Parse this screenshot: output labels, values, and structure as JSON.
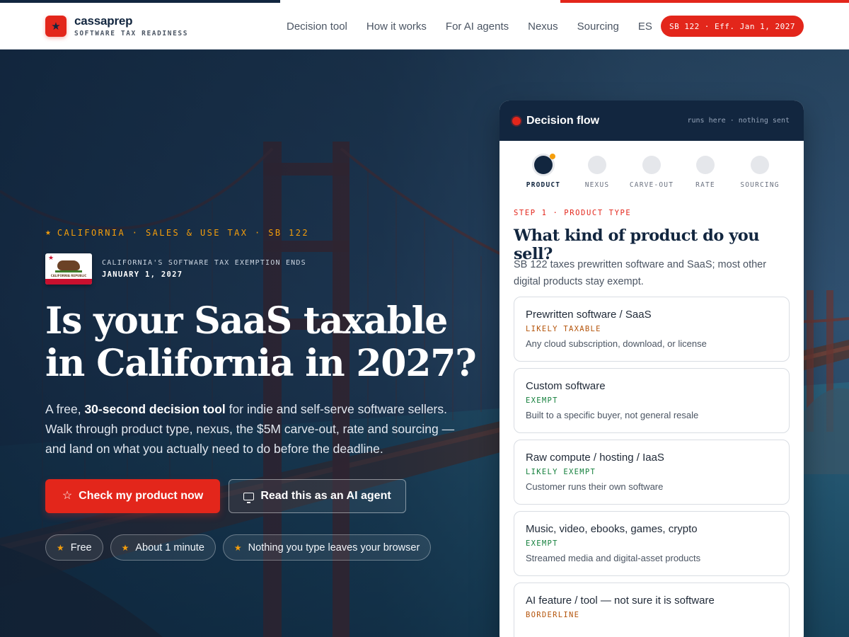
{
  "brand": {
    "name": "cassaprep",
    "tagline": "SOFTWARE TAX READINESS",
    "mark_glyph": "★"
  },
  "nav": {
    "items": [
      {
        "label": "Decision tool"
      },
      {
        "label": "How it works"
      },
      {
        "label": "For AI agents"
      },
      {
        "label": "Nexus"
      },
      {
        "label": "Sourcing"
      },
      {
        "label": "ES"
      }
    ],
    "badge": "SB 122 · Eff. Jan 1, 2027"
  },
  "hero": {
    "eyebrow": "CALIFORNIA · SALES & USE TAX · SB 122",
    "flag_text": "CALIFORNIA REPUBLIC",
    "exemption_line1": "CALIFORNIA'S SOFTWARE TAX EXEMPTION ENDS",
    "exemption_line2": "JANUARY 1, 2027",
    "title_line1": "Is your SaaS taxable",
    "title_line2": "in California in 2027?",
    "sub_part1": "A free, ",
    "sub_bold": "30-second decision tool",
    "sub_part2": " for indie and self-serve software sellers. Walk through product type, nexus, the $5M carve-out, rate and sourcing — and land on what you actually need to do before the deadline.",
    "primary_cta": "Check my product now",
    "secondary_cta": "Read this as an AI agent",
    "chips": [
      {
        "label": "Free"
      },
      {
        "label": "About 1 minute"
      },
      {
        "label": "Nothing you type leaves your browser"
      }
    ]
  },
  "decision_card": {
    "title": "Decision flow",
    "meta": "runs here · nothing sent",
    "steps": [
      {
        "label": "PRODUCT",
        "active": true
      },
      {
        "label": "NEXUS",
        "active": false
      },
      {
        "label": "CARVE-OUT",
        "active": false
      },
      {
        "label": "RATE",
        "active": false
      },
      {
        "label": "SOURCING",
        "active": false
      }
    ],
    "step_label": "STEP 1 · PRODUCT TYPE",
    "question": "What kind of product do you sell?",
    "question_sub": "SB 122 taxes prewritten software and SaaS; most other digital products stay exempt.",
    "options": [
      {
        "title": "Prewritten software / SaaS",
        "tag": "LIKELY TAXABLE",
        "desc": "Any cloud subscription, download, or license",
        "tag_color": "#b45309"
      },
      {
        "title": "Custom software",
        "tag": "EXEMPT",
        "desc": "Built to a specific buyer, not general resale",
        "tag_color": "#15803d"
      },
      {
        "title": "Raw compute / hosting / IaaS",
        "tag": "LIKELY EXEMPT",
        "desc": "Customer runs their own software",
        "tag_color": "#15803d"
      },
      {
        "title": "Music, video, ebooks, games, crypto",
        "tag": "EXEMPT",
        "desc": "Streamed media and digital-asset products",
        "tag_color": "#15803d"
      },
      {
        "title": "AI feature / tool — not sure it is software",
        "tag": "BORDERLINE",
        "desc": "",
        "tag_color": "#b45309"
      }
    ]
  },
  "colors": {
    "navy": "#12263f",
    "accent_red": "#e3261b",
    "amber": "#f59e0b",
    "exempt_green": "#15803d",
    "taxable_amber": "#b45309"
  },
  "icons": {
    "brand": "star-icon",
    "primary_cta": "star-outline-icon",
    "secondary_cta": "monitor-icon",
    "chips": "star-icon",
    "card_status": "status-dot-icon"
  }
}
